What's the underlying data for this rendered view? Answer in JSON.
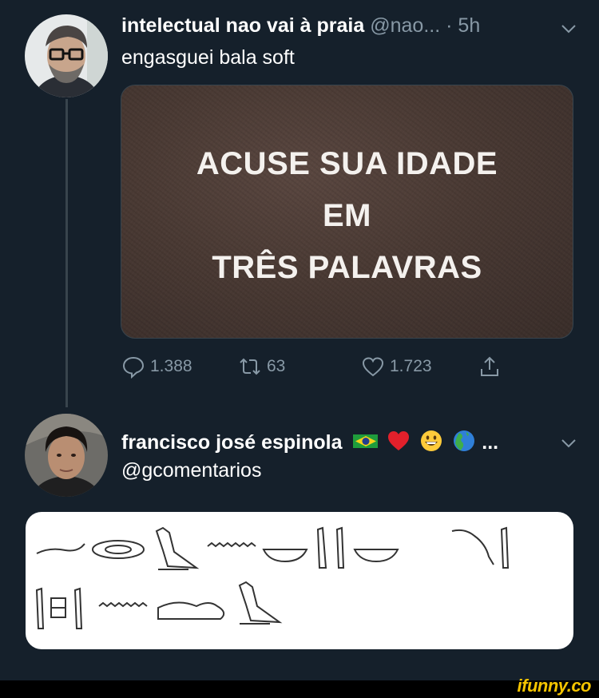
{
  "tweet1": {
    "display_name": "intelectual nao vai à praia",
    "handle": "@nao...",
    "time": "· 5h",
    "text": "engasguei bala soft",
    "image_lines": [
      "ACUSE SUA IDADE",
      "EM",
      "TRÊS PALAVRAS"
    ],
    "replies": "1.388",
    "retweets": "63",
    "likes": "1.723"
  },
  "tweet2": {
    "display_name": "francisco josé espinola",
    "name_ellipsis": "...",
    "handle": "@gcomentarios",
    "emojis": [
      "brazil-flag",
      "red-heart",
      "grinning-face",
      "globe-americas"
    ]
  },
  "watermark": "ifunny.co",
  "colors": {
    "background": "#15202b",
    "muted_text": "#8899a6",
    "divider": "#38444d",
    "watermark": "#f5c400"
  }
}
